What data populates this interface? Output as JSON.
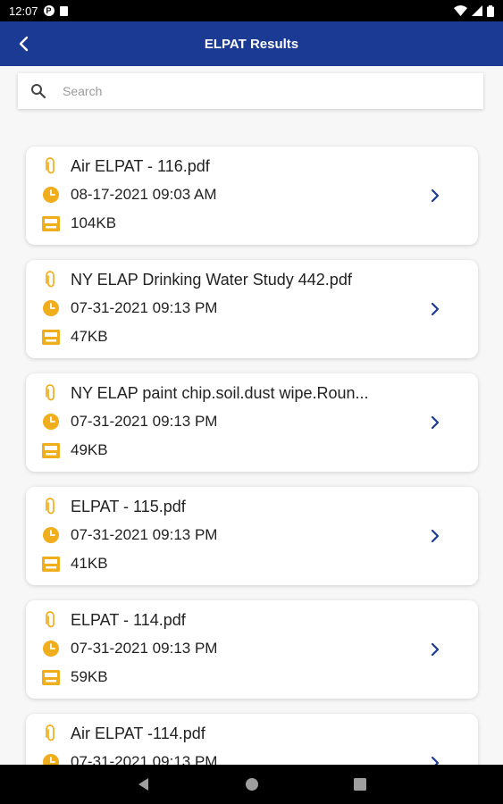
{
  "status_bar": {
    "time": "12:07",
    "p_badge": "P"
  },
  "header": {
    "title": "ELPAT Results",
    "back_icon": "back-arrow-icon"
  },
  "search": {
    "placeholder": "Search",
    "value": ""
  },
  "colors": {
    "header_bg": "#1b3a93",
    "icon_accent": "#f0ad1c",
    "chevron": "#1b3a93"
  },
  "files": [
    {
      "name": "Air ELPAT - 116.pdf",
      "date": "08-17-2021 09:03 AM",
      "size": "104KB"
    },
    {
      "name": "NY ELAP Drinking Water Study 442.pdf",
      "date": "07-31-2021 09:13 PM",
      "size": "47KB"
    },
    {
      "name": "NY ELAP paint chip.soil.dust wipe.Roun...",
      "date": "07-31-2021 09:13 PM",
      "size": "49KB"
    },
    {
      "name": "ELPAT - 115.pdf",
      "date": "07-31-2021 09:13 PM",
      "size": "41KB"
    },
    {
      "name": "ELPAT - 114.pdf",
      "date": "07-31-2021 09:13 PM",
      "size": "59KB"
    },
    {
      "name": "Air ELPAT -114.pdf",
      "date": "07-31-2021 09:13 PM",
      "size": ""
    }
  ]
}
